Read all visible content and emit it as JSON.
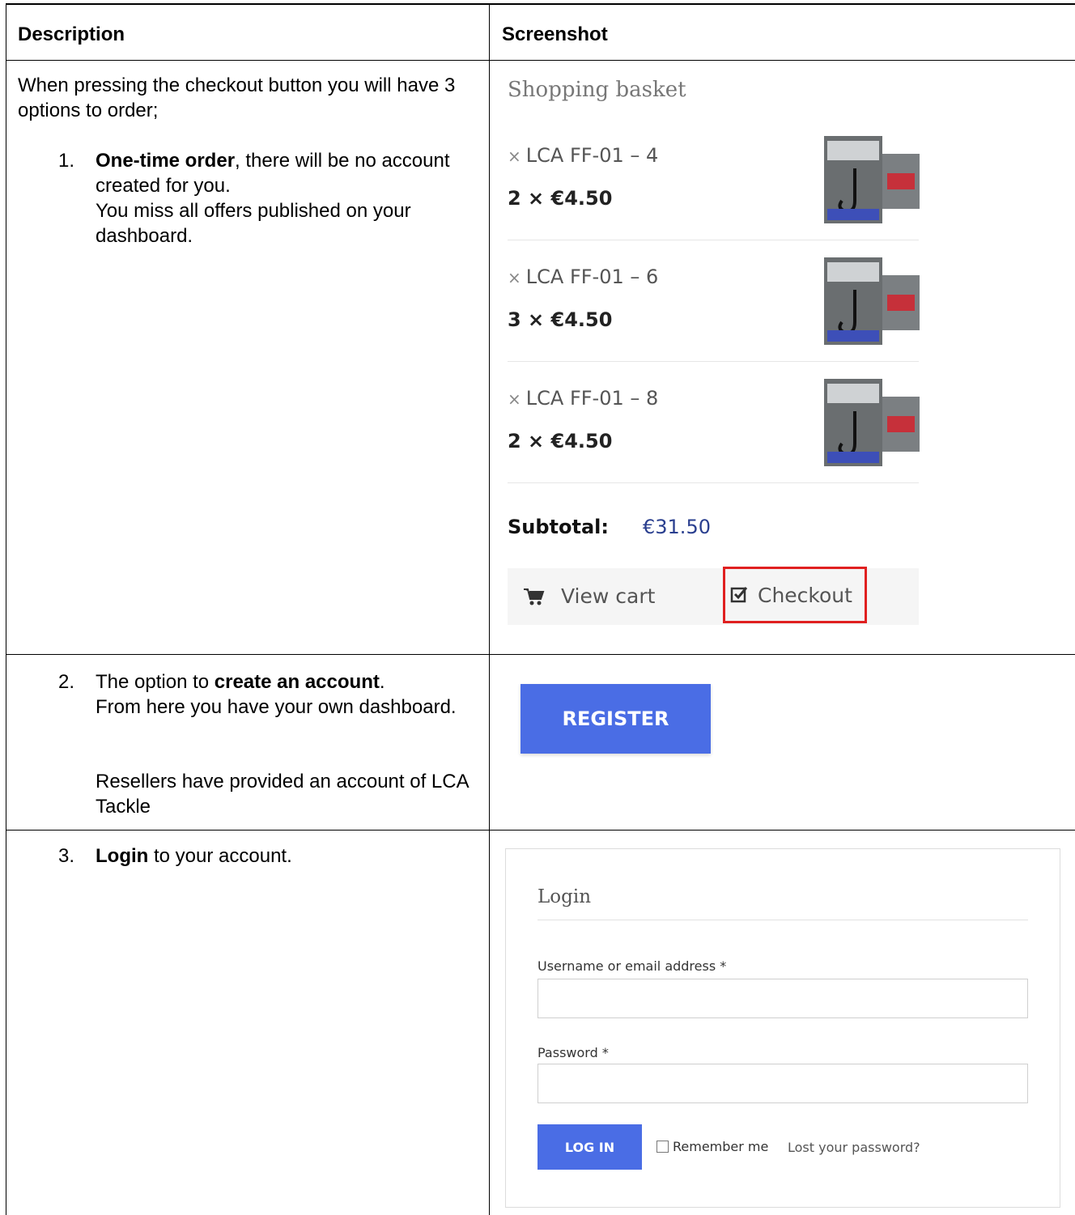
{
  "table": {
    "headers": {
      "description": "Description",
      "screenshot": "Screenshot"
    }
  },
  "row1": {
    "intro": "When pressing the checkout button you will have 3 options to order;",
    "item1": {
      "number": "1.",
      "bold": "One-time order",
      "rest": ", there will be no account created for you.",
      "line2": "You miss all offers published on your dashboard."
    }
  },
  "basket": {
    "title": "Shopping basket",
    "remove_symbol": "×",
    "items": [
      {
        "name": "LCA FF-01 – 4",
        "qty": "2 × €4.50"
      },
      {
        "name": "LCA FF-01 – 6",
        "qty": "3 × €4.50"
      },
      {
        "name": "LCA FF-01 – 8",
        "qty": "2 × €4.50"
      }
    ],
    "subtotal_label": "Subtotal:",
    "subtotal_value": "€31.50",
    "view_cart": "View cart",
    "checkout": "Checkout",
    "icons": {
      "cart": "cart-icon",
      "checkout": "checkbox-checked-icon"
    },
    "highlight_color": "#e02020"
  },
  "row2": {
    "number": "2.",
    "pre": "The option to ",
    "bold": "create an account",
    "post": ".",
    "line2": "From here you have your own dashboard.",
    "line3": "Resellers have provided an account of LCA Tackle",
    "register_label": "REGISTER",
    "button_color": "#4a6de5"
  },
  "row3": {
    "number": "3.",
    "bold": "Login",
    "post": " to your account.",
    "login": {
      "title": "Login",
      "username_label": "Username or email address *",
      "password_label": "Password *",
      "login_button": "LOG IN",
      "remember": "Remember me",
      "lost_password": "Lost your password?"
    }
  }
}
